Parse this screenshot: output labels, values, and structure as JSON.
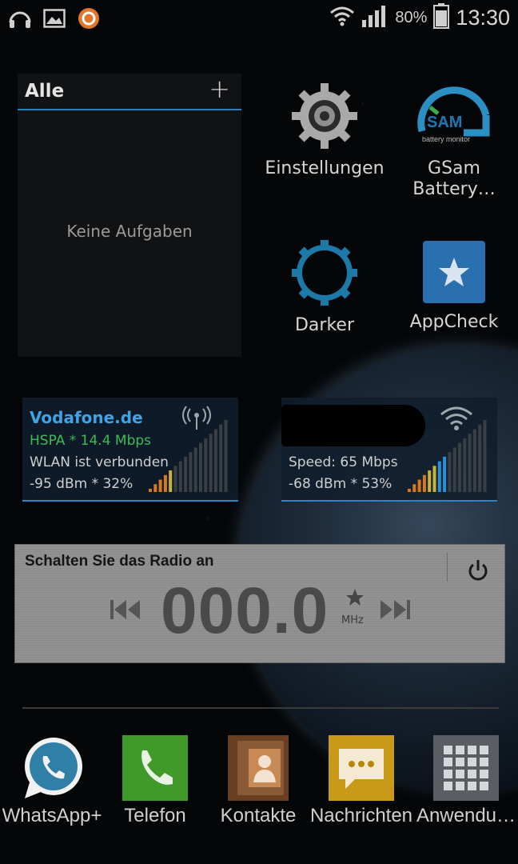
{
  "status_bar": {
    "left_icons": [
      "headphones-icon",
      "image-icon",
      "ring-app-icon"
    ],
    "battery_percent": "80%",
    "time": "13:30"
  },
  "tasks_widget": {
    "title": "Alle",
    "add_label": "+",
    "empty_text": "Keine Aufgaben"
  },
  "apps": [
    {
      "label": "Einstellungen",
      "icon": "settings-gear-icon"
    },
    {
      "label": "GSam Battery…",
      "icon": "gsam-battery-icon",
      "icon_text": "SAM",
      "icon_subtext": "battery monitor"
    },
    {
      "label": "Darker",
      "icon": "darker-gear-icon"
    },
    {
      "label": "AppCheck",
      "icon": "appcheck-star-icon"
    }
  ],
  "signal_widgets": {
    "mobile": {
      "title": "Vodafone.de",
      "network": "HSPA * 14.4 Mbps",
      "status": "WLAN ist verbunden",
      "strength": "-95 dBm * 32%",
      "strength_fraction": 0.32
    },
    "wifi": {
      "speed": "Speed: 65 Mbps",
      "strength": "-68 dBm * 53%",
      "strength_fraction": 0.53
    }
  },
  "radio": {
    "title": "Schalten Sie das Radio an",
    "frequency": "000.0",
    "unit": "MHz"
  },
  "dock": [
    {
      "label": "WhatsApp+",
      "icon": "whatsapp-icon"
    },
    {
      "label": "Telefon",
      "icon": "phone-icon"
    },
    {
      "label": "Kontakte",
      "icon": "contacts-icon"
    },
    {
      "label": "Nachrichten",
      "icon": "messages-icon"
    },
    {
      "label": "Anwendu…",
      "icon": "apps-grid-icon"
    }
  ],
  "colors": {
    "accent_blue": "#2a86c8",
    "title_blue": "#3fa3e6",
    "network_green": "#3dbb58"
  }
}
